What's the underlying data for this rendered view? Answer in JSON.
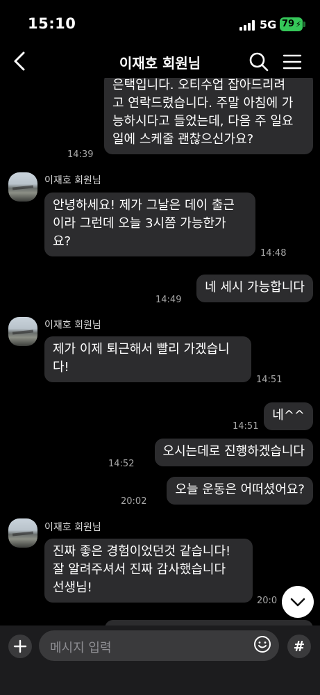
{
  "status_bar": {
    "time": "15:10",
    "network": "5G",
    "battery": "79"
  },
  "header": {
    "title": "이재호 회원님"
  },
  "messages": [
    {
      "from": "me",
      "text": "은택입니다. 오티수업 잡아드리려\n고 연락드렸습니다. 주말 아침에 가\n능하시다고 들었는데, 다음 주 일요\n일에 스케줄 괜찮으신가요?",
      "time": "14:39"
    },
    {
      "from": "other",
      "sender": "이재호 회원님",
      "text": "안녕하세요! 제가 그날은 데이 출근\n이라 그런데 오늘 3시쯤 가능한가\n요?",
      "time": "14:48"
    },
    {
      "from": "me",
      "text": "네 세시 가능합니다",
      "time": "14:49"
    },
    {
      "from": "other",
      "sender": "이재호 회원님",
      "text": "제가 이제 퇴근해서 빨리 가겠습니\n다!",
      "time": "14:51"
    },
    {
      "from": "me",
      "text": "네^^",
      "time": "14:51"
    },
    {
      "from": "me",
      "text": "오시는데로 진행하겠습니다",
      "time": "14:52"
    },
    {
      "from": "me",
      "text": "오늘 운동은 어떠셨어요?",
      "time": "20:02"
    },
    {
      "from": "other",
      "sender": "이재호 회원님",
      "text": "진짜 좋은 경험이었던것 같습니다!\n잘 알려주셔서 진짜 감사했습니다\n선생님!",
      "time": "20:0"
    }
  ],
  "input": {
    "placeholder": "메시지 입력"
  },
  "icons": {
    "back": "chevron-left-icon",
    "search": "search-icon",
    "menu": "hamburger-menu-icon",
    "scroll_down": "chevron-down-icon",
    "add": "plus-icon",
    "emoji": "smiley-icon",
    "hash": "hashtag-icon"
  },
  "colors": {
    "background": "#000000",
    "bubble": "#2c2c2e",
    "battery": "#35c759"
  }
}
